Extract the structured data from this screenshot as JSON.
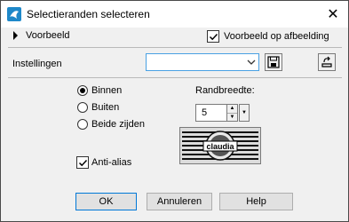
{
  "window": {
    "title": "Selectieranden selecteren",
    "icon": "app-icon",
    "close_icon": "close-icon"
  },
  "preview": {
    "toggle_label": "Voorbeeld",
    "check_label": "Voorbeeld op afbeelding",
    "check_checked": true
  },
  "settings": {
    "label": "Instellingen",
    "value": "",
    "save_icon": "save-icon",
    "reset_icon": "reset-icon"
  },
  "options": {
    "radios": [
      {
        "label": "Binnen",
        "selected": true
      },
      {
        "label": "Buiten",
        "selected": false
      },
      {
        "label": "Beide zijden",
        "selected": false
      }
    ],
    "border_width_label": "Randbreedte:",
    "border_width_value": "5",
    "antialias_label": "Anti-alias",
    "antialias_checked": true,
    "preview_logo_text": "claudia"
  },
  "buttons": {
    "ok": "OK",
    "cancel": "Annuleren",
    "help": "Help"
  },
  "colors": {
    "accent": "#0078d7",
    "combo_border": "#4aa1e3"
  }
}
